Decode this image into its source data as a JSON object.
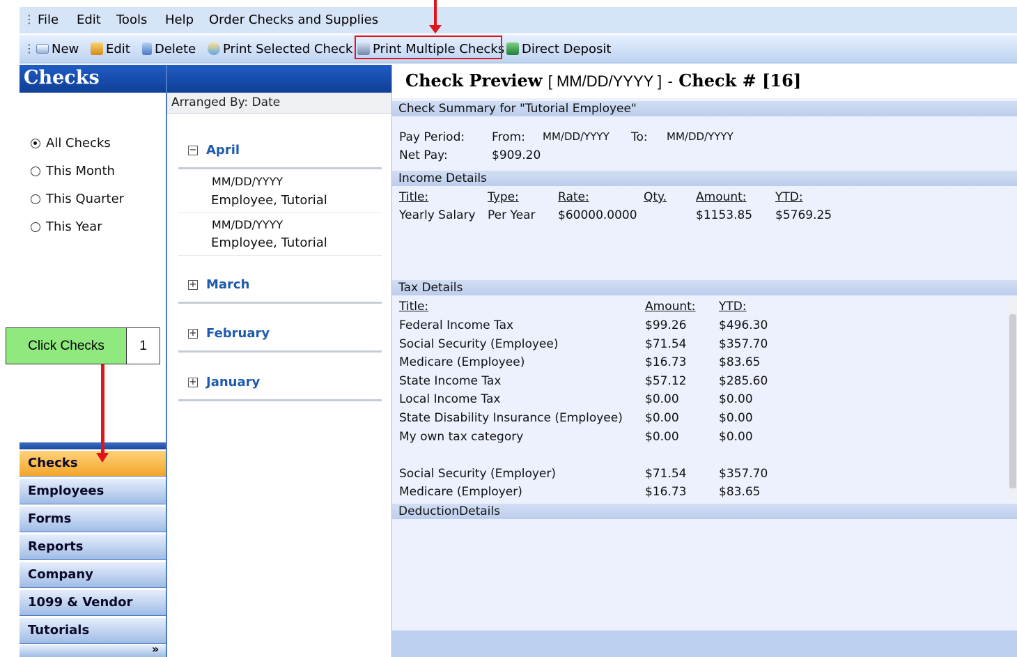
{
  "menu": {
    "items": [
      "File",
      "Edit",
      "Tools",
      "Help",
      "Order Checks and Supplies"
    ]
  },
  "toolbar": {
    "new": "New",
    "edit": "Edit",
    "delete": "Delete",
    "print_selected": "Print Selected Check",
    "print_multiple": "Print Multiple Checks",
    "direct_deposit": "Direct Deposit"
  },
  "left": {
    "title": "Checks",
    "filters": [
      "All Checks",
      "This Month",
      "This Quarter",
      "This Year"
    ],
    "selected_filter": "All Checks",
    "nav": [
      "Checks",
      "Employees",
      "Forms",
      "Reports",
      "Company",
      "1099 & Vendor",
      "Tutorials"
    ],
    "active_nav": "Checks",
    "more": "»"
  },
  "middle": {
    "arranged_by": "Arranged By: Date",
    "groups": [
      {
        "name": "April",
        "toggle": "−",
        "expanded": true
      },
      {
        "name": "March",
        "toggle": "+",
        "expanded": false
      },
      {
        "name": "February",
        "toggle": "+",
        "expanded": false
      },
      {
        "name": "January",
        "toggle": "+",
        "expanded": false
      }
    ],
    "entries": [
      {
        "date": "MM/DD/YYYY",
        "name": "Employee, Tutorial"
      },
      {
        "date": "MM/DD/YYYY",
        "name": "Employee, Tutorial"
      }
    ]
  },
  "preview": {
    "title_bold": "Check Preview",
    "title_date": "[ MM/DD/YYYY ]",
    "title_dash": "-",
    "title_check": "Check # [16]",
    "summary_bar": "Check Summary for \"Tutorial Employee\"",
    "pay_period_label": "Pay Period:",
    "from_label": "From:",
    "from_value": "MM/DD/YYYY",
    "to_label": "To:",
    "to_value": "MM/DD/YYYY",
    "net_pay_label": "Net Pay:",
    "net_pay_value": "$909.20",
    "income_bar": "Income Details",
    "income_headers": [
      "Title:",
      "Type:",
      "Rate:",
      "Qty.",
      "Amount:",
      "YTD:"
    ],
    "income_rows": [
      [
        "Yearly Salary",
        "Per Year",
        "$60000.0000",
        "",
        "$1153.85",
        "$5769.25"
      ]
    ],
    "tax_bar": "Tax Details",
    "tax_headers": [
      "Title:",
      "Amount:",
      "YTD:"
    ],
    "tax_rows": [
      [
        "Federal Income Tax",
        "$99.26",
        "$496.30"
      ],
      [
        "Social Security (Employee)",
        "$71.54",
        "$357.70"
      ],
      [
        "Medicare (Employee)",
        "$16.73",
        "$83.65"
      ],
      [
        "State Income Tax",
        "$57.12",
        "$285.60"
      ],
      [
        "Local Income Tax",
        "$0.00",
        "$0.00"
      ],
      [
        "State Disability Insurance (Employee)",
        "$0.00",
        "$0.00"
      ],
      [
        "My own tax category",
        "$0.00",
        "$0.00"
      ],
      [
        "Social Security (Employer)",
        "$71.54",
        "$357.70"
      ],
      [
        "Medicare (Employer)",
        "$16.73",
        "$83.65"
      ]
    ],
    "deduction_bar": "DeductionDetails"
  },
  "annotation": {
    "label": "Click Checks",
    "step": "1"
  },
  "colors": {
    "accent_red": "#e0151b",
    "callout_green": "#8fe97f",
    "nav_active": "#f4a52b",
    "header_blue": "#1f5cc3"
  }
}
